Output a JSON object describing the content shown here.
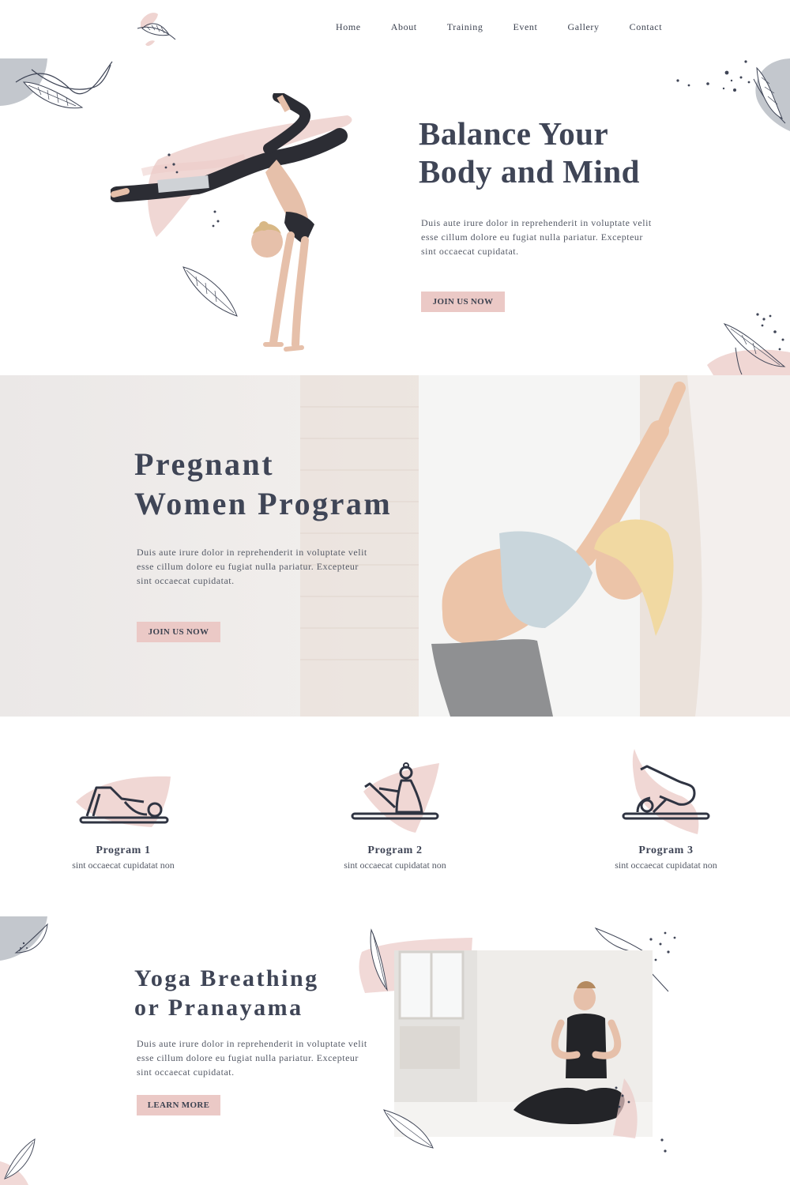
{
  "nav": {
    "items": [
      "Home",
      "About",
      "Training",
      "Event",
      "Gallery",
      "Contact"
    ]
  },
  "hero": {
    "title_line1": "Balance Your",
    "title_line2": "Body and Mind",
    "body": "Duis aute irure dolor in reprehenderit in voluptate velit esse cillum dolore eu fugiat nulla pariatur. Excepteur sint occaecat cupidatat.",
    "button": "JOIN US NOW"
  },
  "banner": {
    "title_line1": "Pregnant",
    "title_line2": "Women Program",
    "body": "Duis aute irure dolor in reprehenderit in voluptate velit esse cillum dolore eu fugiat nulla pariatur. Excepteur sint occaecat cupidatat.",
    "button": "JOIN US NOW"
  },
  "programs": [
    {
      "title": "Program 1",
      "subtitle": "sint occaecat cupidatat non",
      "icon": "bridge-pose-icon"
    },
    {
      "title": "Program 2",
      "subtitle": "sint occaecat cupidatat non",
      "icon": "boat-pose-icon"
    },
    {
      "title": "Program 3",
      "subtitle": "sint occaecat cupidatat non",
      "icon": "plow-pose-icon"
    }
  ],
  "yoga": {
    "title_line1": "Yoga Breathing",
    "title_line2": "or Pranayama",
    "body": "Duis aute irure dolor in reprehenderit in voluptate velit esse cillum dolore eu fugiat nulla pariatur. Excepteur sint occaecat cupidatat.",
    "button": "LEARN MORE"
  },
  "colors": {
    "accent_pink": "#ebc9c6",
    "text_dark": "#3f4556",
    "decor_grey": "#c3c7cd"
  }
}
